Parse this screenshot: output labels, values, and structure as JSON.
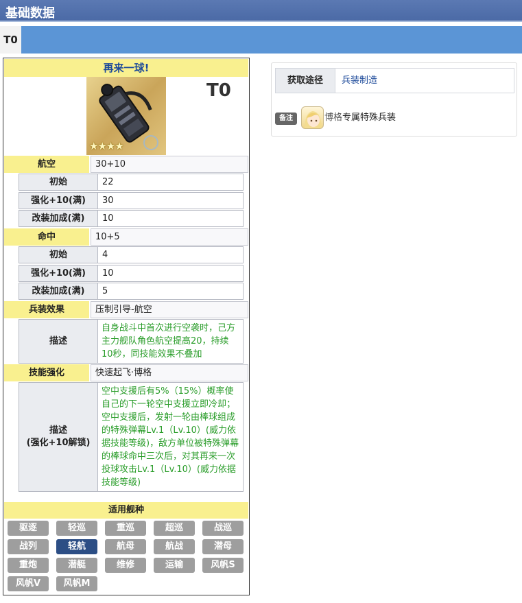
{
  "header": {
    "title": "基础数据"
  },
  "tabs": [
    {
      "label": "T0",
      "active": true
    }
  ],
  "card": {
    "name": "再来一球!",
    "tier": "T0",
    "rarity_stars": "★★★★",
    "stats": {
      "air": {
        "label": "航空",
        "value": "30+10",
        "rows": [
          {
            "label": "初始",
            "value": "22"
          },
          {
            "label": "强化+10(满)",
            "value": "30"
          },
          {
            "label": "改装加成(满)",
            "value": "10"
          }
        ]
      },
      "hit": {
        "label": "命中",
        "value": "10+5",
        "rows": [
          {
            "label": "初始",
            "value": "4"
          },
          {
            "label": "强化+10(满)",
            "value": "10"
          },
          {
            "label": "改装加成(满)",
            "value": "5"
          }
        ]
      }
    },
    "effect": {
      "label": "兵装效果",
      "value": "压制引导-航空",
      "desc_label": "描述",
      "desc": "自身战斗中首次进行空袭时，己方主力舰队角色航空提高20，持续10秒，同技能效果不叠加"
    },
    "skill": {
      "label": "技能强化",
      "value": "快速起飞·博格",
      "desc_label_1": "描述",
      "desc_label_2": "(强化+10解锁)",
      "desc": "空中支援后有5%（15%）概率使自己的下一轮空中支援立即冷却；空中支援后，发射一轮由棒球组成的特殊弹幕Lv.1（Lv.10）(威力依据技能等级)，敌方单位被特殊弹幕的棒球命中三次后，对其再来一次投球攻击Lv.1（Lv.10）(威力依据技能等级)"
    },
    "ship_types": {
      "label": "适用舰种",
      "items": [
        "驱逐",
        "轻巡",
        "重巡",
        "超巡",
        "战巡",
        "战列",
        "轻航",
        "航母",
        "航战",
        "潜母",
        "重炮",
        "潜艇",
        "维修",
        "运输",
        "风帆S",
        "风帆V",
        "风帆M"
      ],
      "active": "轻航"
    }
  },
  "info": {
    "source_label": "获取途径",
    "source_value": "兵装制造",
    "note_badge": "备注",
    "note_link": "博格",
    "note_text": "专属特殊兵装"
  },
  "colors": {
    "header": "#4b6aa6",
    "tab_bar": "#5b95d6",
    "label_yellow": "#f9f08f",
    "desc_green": "#2a9d2a",
    "active_ship": "#2c4e85"
  },
  "icons": {
    "equipment": "aircraft-launcher-icon",
    "avatar": "bogue-avatar-icon"
  }
}
